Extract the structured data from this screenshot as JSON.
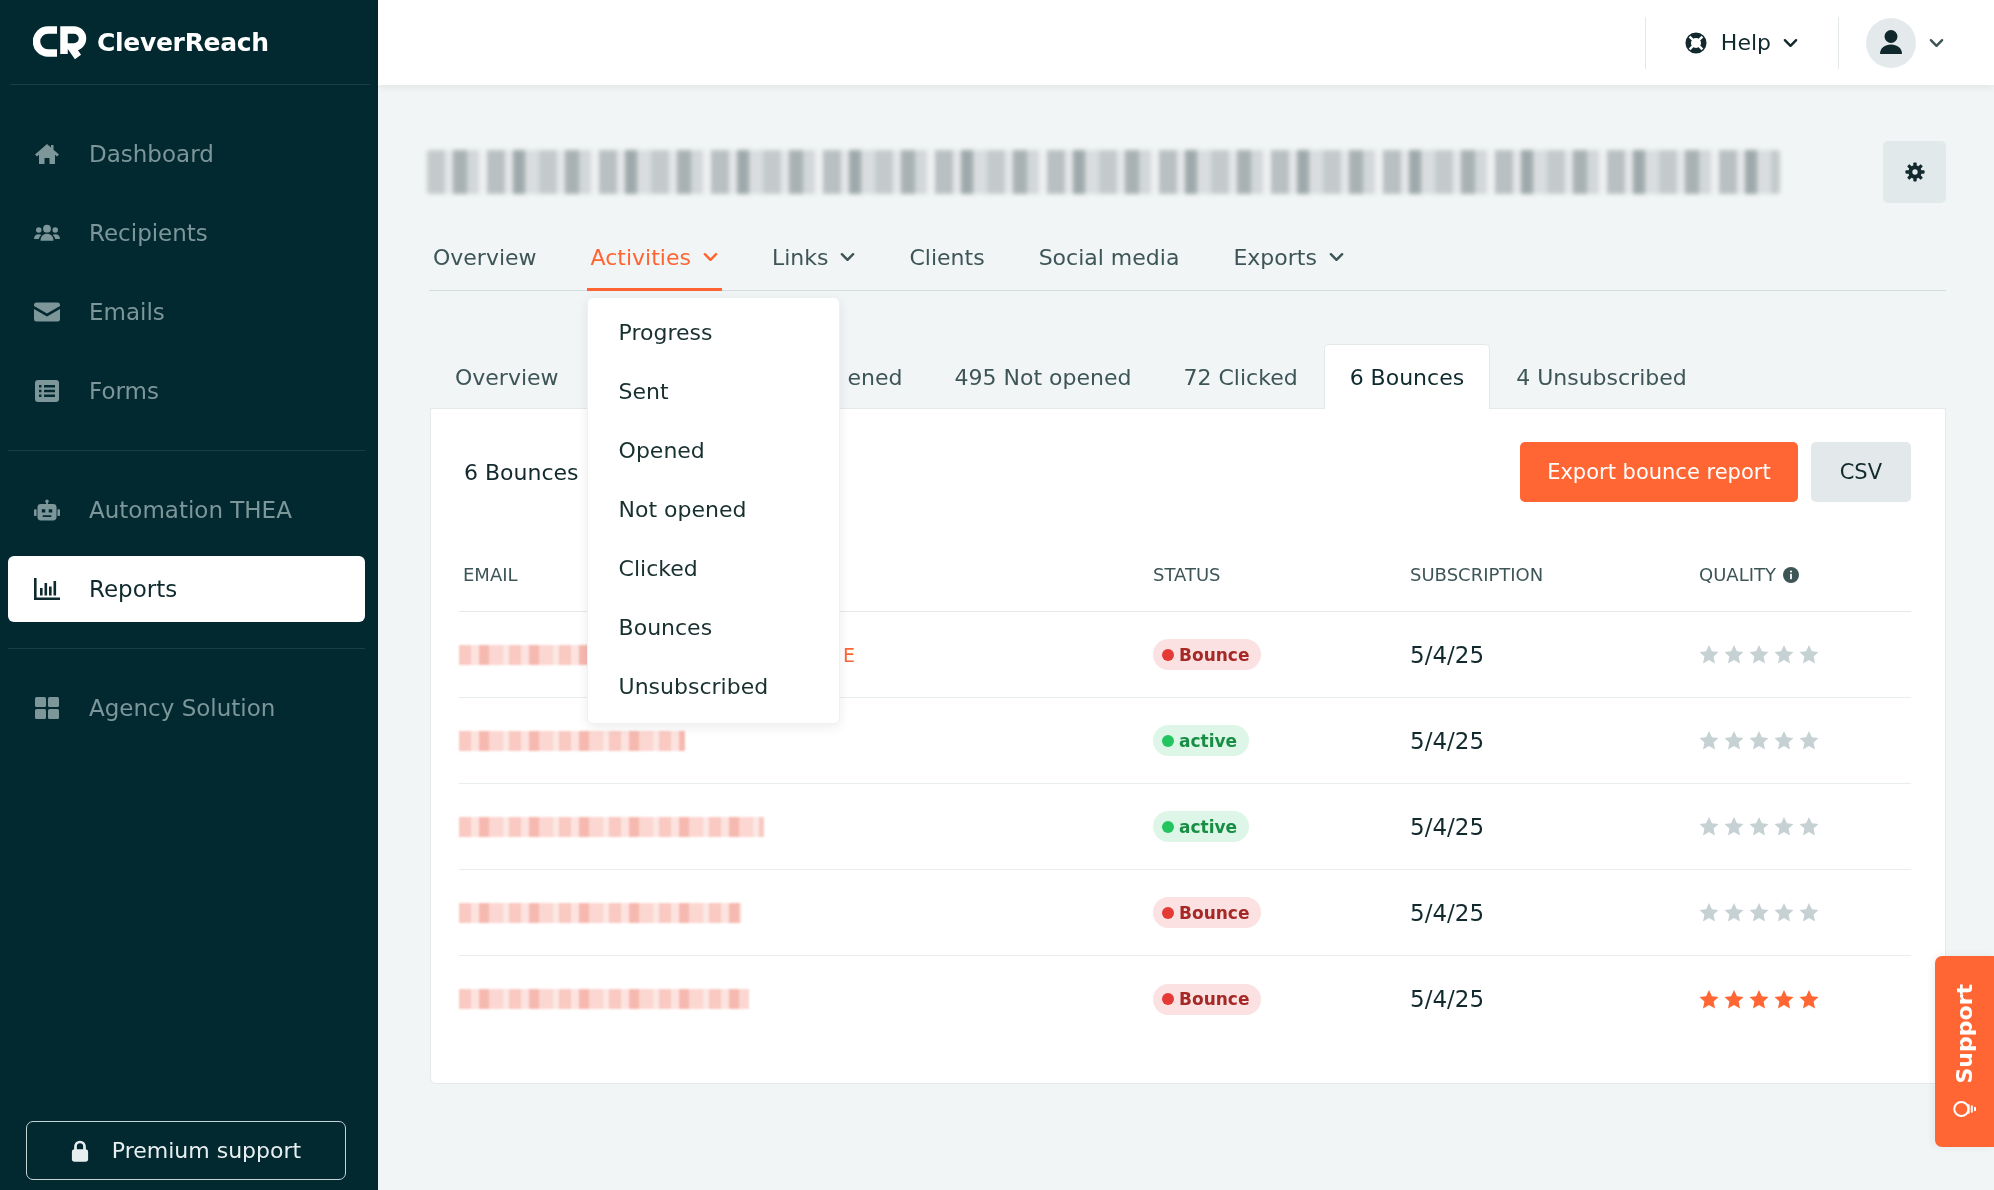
{
  "sidebar": {
    "logo": "CleverReach",
    "sections": [
      {
        "items": [
          {
            "label": "Dashboard",
            "selected": false
          },
          {
            "label": "Recipients",
            "selected": false
          },
          {
            "label": "Emails",
            "selected": false
          },
          {
            "label": "Forms",
            "selected": false
          }
        ]
      },
      {
        "items": [
          {
            "label": "Automation THEA",
            "selected": false
          },
          {
            "label": "Reports",
            "selected": true
          }
        ]
      },
      {
        "items": [
          {
            "label": "Agency Solution",
            "selected": false
          }
        ]
      }
    ],
    "premium_button": {
      "label": "Premium support"
    }
  },
  "top_bar": {
    "help": {
      "label": "Help"
    }
  },
  "report": {
    "tabs": [
      {
        "label": "Overview",
        "selected": false,
        "has_menu": false
      },
      {
        "label": "Activities",
        "selected": true,
        "has_menu": true,
        "menu": [
          "Progress",
          "Sent",
          "Opened",
          "Not opened",
          "Clicked",
          "Bounces",
          "Unsubscribed"
        ]
      },
      {
        "label": "Links",
        "selected": false,
        "has_menu": true
      },
      {
        "label": "Clients",
        "selected": false,
        "has_menu": false
      },
      {
        "label": "Social media",
        "selected": false,
        "has_menu": false
      },
      {
        "label": "Exports",
        "selected": false,
        "has_menu": true
      }
    ],
    "activity_tabs": [
      {
        "label": "Overview",
        "selected": false
      },
      {
        "label": "ened",
        "selected": false
      },
      {
        "label": "495 Not opened",
        "selected": false
      },
      {
        "label": "72 Clicked",
        "selected": false
      },
      {
        "label": "6 Bounces",
        "selected": true
      },
      {
        "label": "4 Unsubscribed",
        "selected": false
      }
    ],
    "panel": {
      "count": "6 Bounces",
      "buttons": [
        {
          "label": "Export bounce report",
          "kind": "primary"
        },
        {
          "label": "CSV",
          "kind": "secondary"
        }
      ],
      "table": {
        "columns": [
          {
            "label": "EMAIL",
            "info": false
          },
          {
            "label": "STATUS",
            "info": false
          },
          {
            "label": "SUBSCRIPTION",
            "info": false
          },
          {
            "label": "QUALITY",
            "info": true
          }
        ],
        "rows": [
          {
            "note": "E",
            "status": {
              "label": "Bounce",
              "color": "#e53935"
            },
            "subscription": "5/4/25",
            "stars": 0
          },
          {
            "status": {
              "label": "active",
              "color": "#22c55e"
            },
            "subscription": "5/4/25",
            "stars": 0
          },
          {
            "status": {
              "label": "active",
              "color": "#22c55e"
            },
            "subscription": "5/4/25",
            "stars": 0
          },
          {
            "status": {
              "label": "Bounce",
              "color": "#e53935"
            },
            "subscription": "5/4/25",
            "stars": 0
          },
          {
            "status": {
              "label": "Bounce",
              "color": "#e53935"
            },
            "subscription": "5/4/25",
            "stars": 5
          }
        ]
      }
    }
  },
  "support_tab": {
    "label": "Support"
  }
}
